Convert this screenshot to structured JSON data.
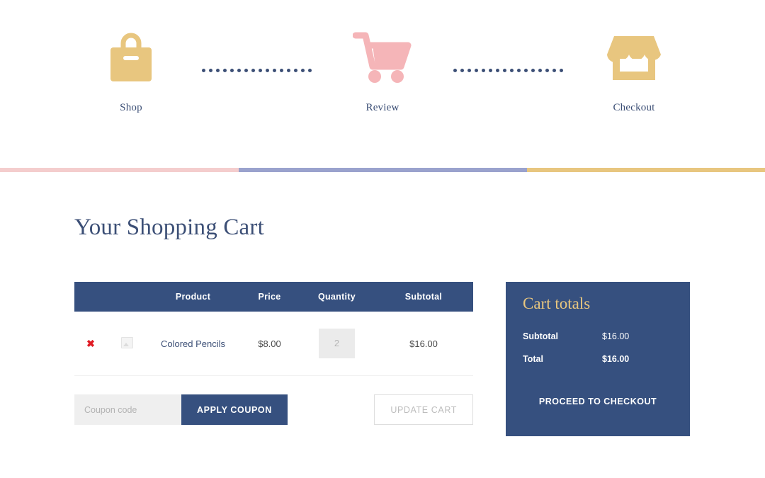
{
  "steps": [
    {
      "id": "shop",
      "label": "Shop",
      "icon": "shopping-bag-icon",
      "color": "#e8c67f"
    },
    {
      "id": "review",
      "label": "Review",
      "icon": "shopping-cart-icon",
      "color": "#f5b5b8"
    },
    {
      "id": "checkout",
      "label": "Checkout",
      "icon": "storefront-icon",
      "color": "#e8c67f"
    }
  ],
  "divider": {
    "segments": [
      {
        "name": "pink",
        "color": "#f4cdcd"
      },
      {
        "name": "purple",
        "color": "#9aa2cd"
      },
      {
        "name": "gold",
        "color": "#e8c67f"
      }
    ]
  },
  "page": {
    "title": "Your Shopping Cart"
  },
  "cart_table": {
    "headers": [
      "",
      "",
      "Product",
      "Price",
      "Quantity",
      "Subtotal"
    ],
    "header_product": "Product",
    "header_price": "Price",
    "header_quantity": "Quantity",
    "header_subtotal": "Subtotal",
    "rows": [
      {
        "remove_glyph": "✖",
        "thumbnail": "broken-image-placeholder",
        "name": "Colored Pencils",
        "price": "$8.00",
        "quantity": "2",
        "subtotal": "$16.00"
      }
    ]
  },
  "actions": {
    "coupon_placeholder": "Coupon code",
    "coupon_value": "",
    "apply_label": "APPLY COUPON",
    "update_label": "UPDATE CART"
  },
  "totals": {
    "title": "Cart totals",
    "rows": [
      {
        "label": "Subtotal",
        "value": "$16.00"
      },
      {
        "label": "Total",
        "value": "$16.00"
      }
    ],
    "checkout_label": "PROCEED TO CHECKOUT"
  },
  "colors": {
    "navy": "#36507f",
    "navy_text": "#3c4f76",
    "gold": "#e8c67f",
    "pink": "#f5b5b8",
    "purple": "#9aa2cd",
    "remove_red": "#e01b24"
  }
}
